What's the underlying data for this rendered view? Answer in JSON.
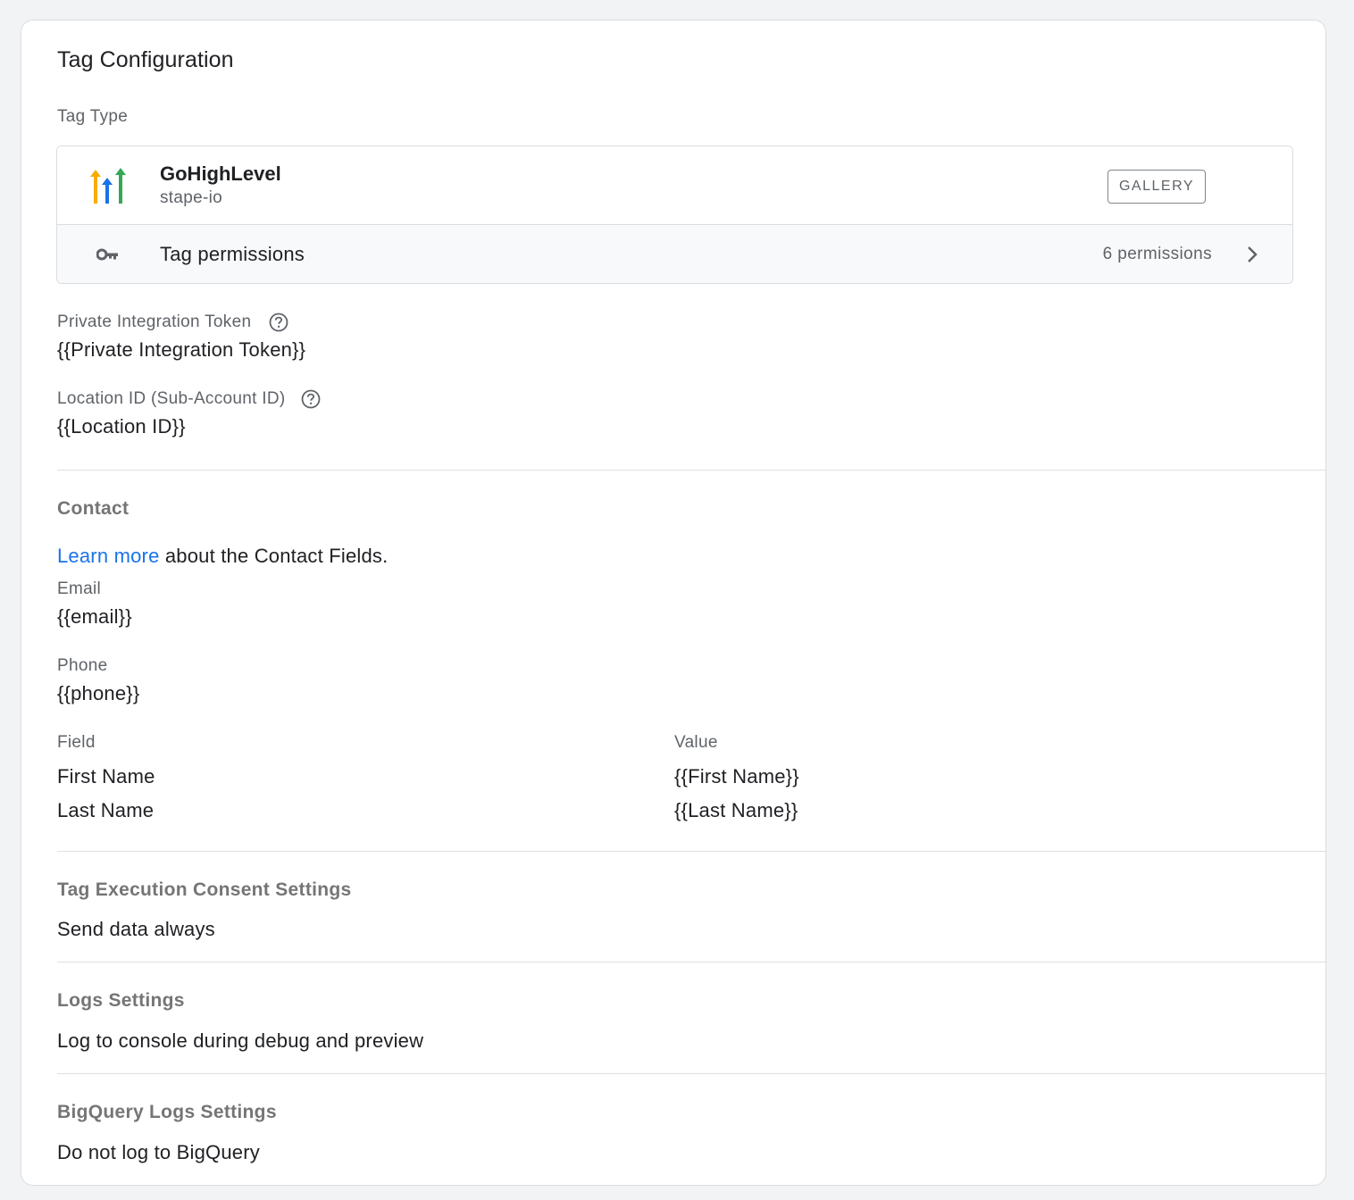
{
  "card": {
    "title": "Tag Configuration"
  },
  "tag_type": {
    "label": "Tag Type",
    "name": "GoHighLevel",
    "vendor": "stape-io",
    "logo_icon": "gohighlevel-logo",
    "gallery_label": "GALLERY",
    "permissions_label": "Tag permissions",
    "permissions_count": "6 permissions",
    "permissions_icon": "key-icon"
  },
  "fields": {
    "token_label": "Private Integration Token",
    "token_value": "{{Private Integration Token}}",
    "location_label": "Location ID (Sub-Account ID)",
    "location_value": "{{Location ID}}"
  },
  "contact": {
    "title": "Contact",
    "learn_more_link": "Learn more",
    "learn_more_text": " about the Contact Fields.",
    "email_label": "Email",
    "email_value": "{{email}}",
    "phone_label": "Phone",
    "phone_value": "{{phone}}",
    "table_headers": [
      "Field",
      "Value"
    ],
    "rows": [
      [
        "First Name",
        "{{First Name}}"
      ],
      [
        "Last Name",
        "{{Last Name}}"
      ]
    ]
  },
  "consent": {
    "title": "Tag Execution Consent Settings",
    "value": "Send data always"
  },
  "logs": {
    "title": "Logs Settings",
    "value": "Log to console during debug and preview"
  },
  "bigquery": {
    "title": "BigQuery Logs Settings",
    "value": "Do not log to BigQuery"
  },
  "colors": {
    "link": "#1a73e8",
    "logo_yellow": "#f9ab00",
    "logo_blue": "#1a73e8",
    "logo_green": "#34a853"
  }
}
